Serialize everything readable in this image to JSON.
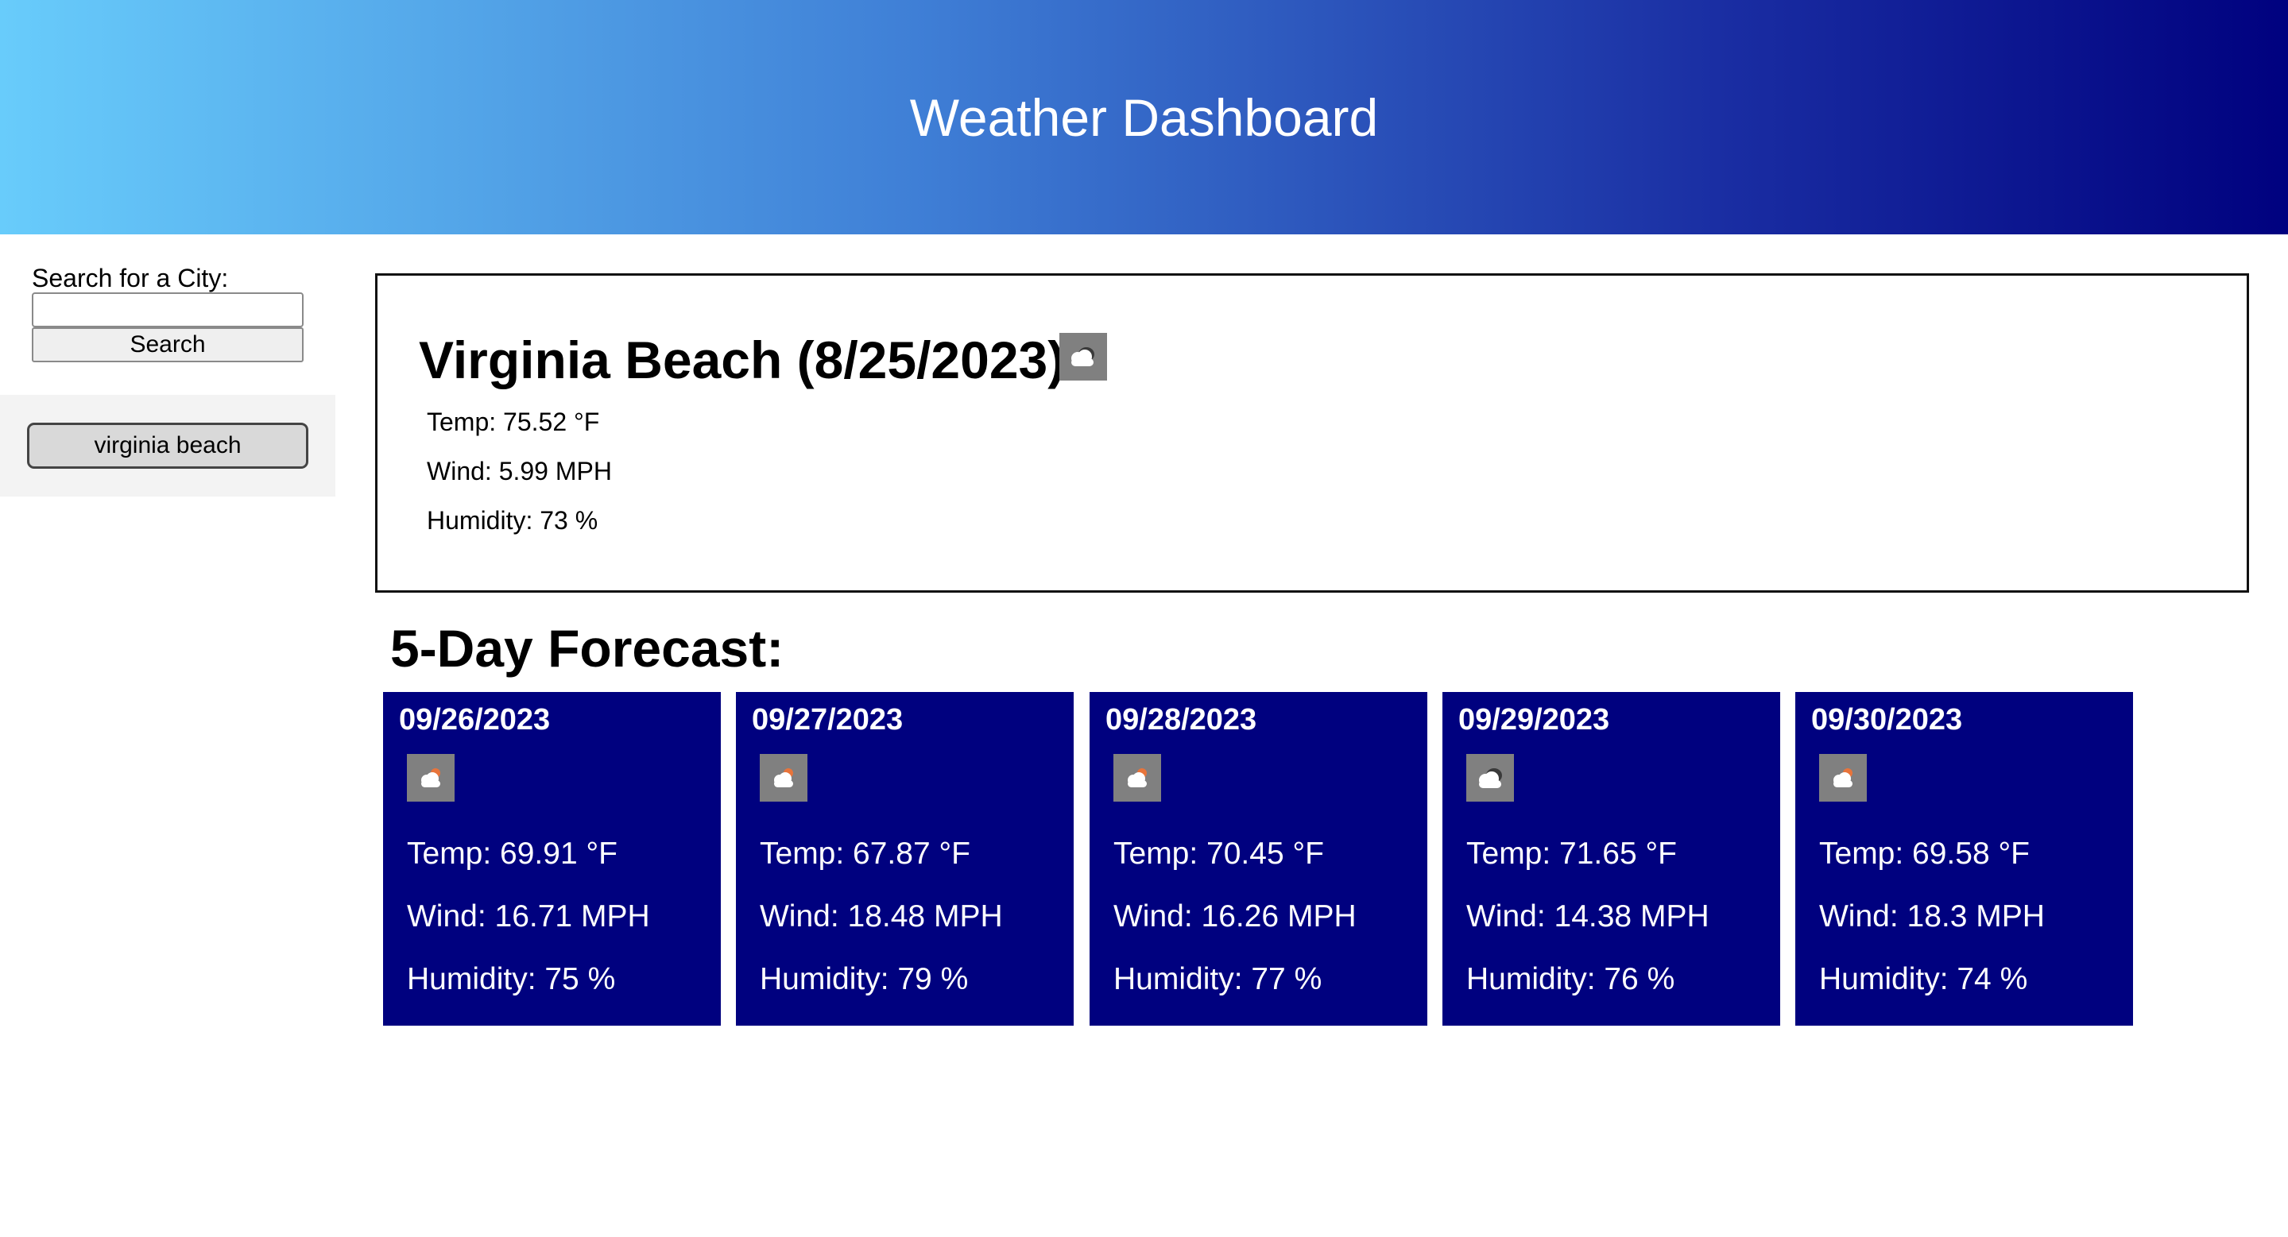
{
  "header": {
    "title": "Weather Dashboard"
  },
  "search": {
    "label": "Search for a City:",
    "input_value": "",
    "button_label": "Search"
  },
  "history": [
    {
      "label": "virginia beach"
    }
  ],
  "current": {
    "title": "Virginia Beach (8/25/2023)",
    "icon": "cloudy-icon",
    "temp": "Temp: 75.52 °F",
    "wind": "Wind: 5.99 MPH",
    "humidity": "Humidity: 73 %"
  },
  "forecast": {
    "heading": "5-Day Forecast:",
    "days": [
      {
        "date": "09/26/2023",
        "icon": "partly-cloudy-icon",
        "temp": "Temp: 69.91 °F",
        "wind": "Wind: 16.71 MPH",
        "humidity": "Humidity: 75 %"
      },
      {
        "date": "09/27/2023",
        "icon": "partly-cloudy-icon",
        "temp": "Temp: 67.87 °F",
        "wind": "Wind: 18.48 MPH",
        "humidity": "Humidity: 79 %"
      },
      {
        "date": "09/28/2023",
        "icon": "partly-cloudy-icon",
        "temp": "Temp: 70.45 °F",
        "wind": "Wind: 16.26 MPH",
        "humidity": "Humidity: 77 %"
      },
      {
        "date": "09/29/2023",
        "icon": "cloudy-icon",
        "temp": "Temp: 71.65 °F",
        "wind": "Wind: 14.38 MPH",
        "humidity": "Humidity: 76 %"
      },
      {
        "date": "09/30/2023",
        "icon": "partly-cloudy-icon",
        "temp": "Temp: 69.58 °F",
        "wind": "Wind: 18.3 MPH",
        "humidity": "Humidity: 74 %"
      }
    ]
  },
  "colors": {
    "header_gradient_start": "#68ccfb",
    "header_gradient_end": "#00017f",
    "card_background": "#00017f",
    "icon_background": "#808080"
  }
}
